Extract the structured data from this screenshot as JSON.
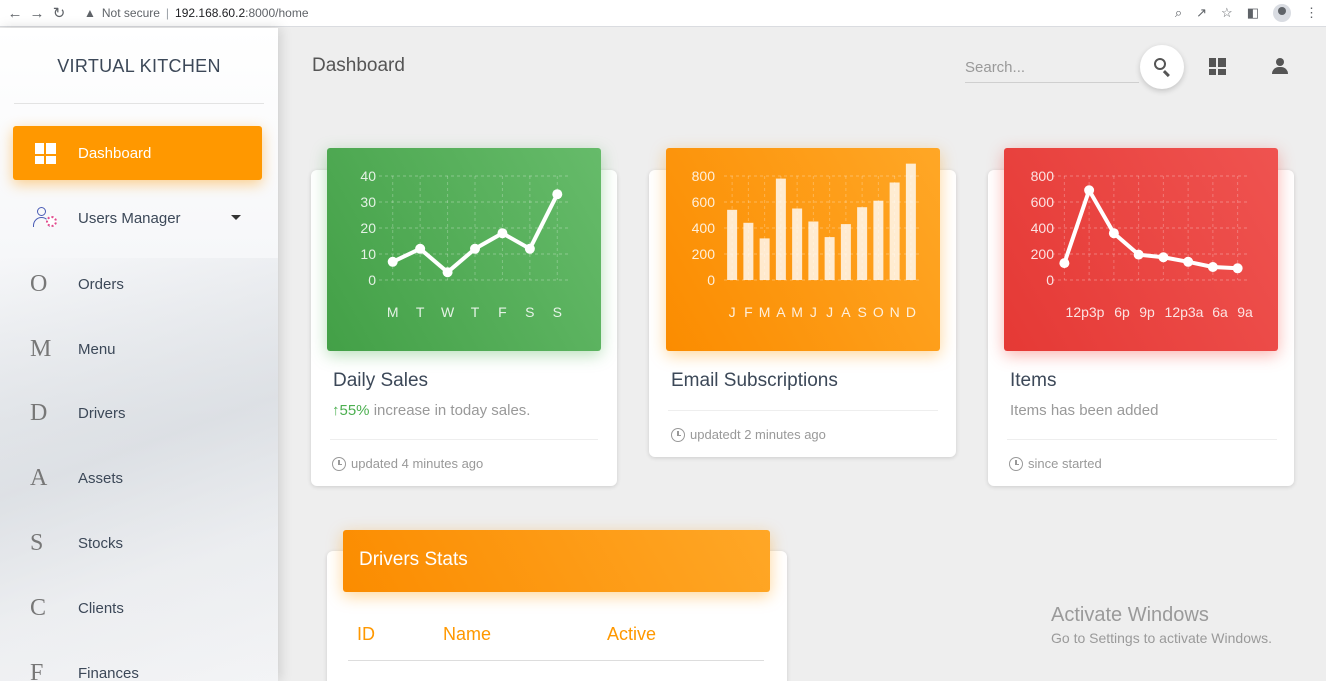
{
  "browser": {
    "warning_text": "Not secure",
    "url_host": "192.168.60.2",
    "url_path": ":8000/home"
  },
  "sidebar": {
    "brand": "VIRTUAL KITCHEN",
    "active_item": "Dashboard",
    "users_manager_label": "Users Manager",
    "items": [
      {
        "letter": "O",
        "label": "Orders"
      },
      {
        "letter": "M",
        "label": "Menu"
      },
      {
        "letter": "D",
        "label": "Drivers"
      },
      {
        "letter": "A",
        "label": "Assets"
      },
      {
        "letter": "S",
        "label": "Stocks"
      },
      {
        "letter": "C",
        "label": "Clients"
      },
      {
        "letter": "F",
        "label": "Finances"
      }
    ]
  },
  "header": {
    "title": "Dashboard",
    "search_placeholder": "Search..."
  },
  "cards": {
    "daily_sales": {
      "title": "Daily Sales",
      "percent": "55%",
      "category": " increase in today sales.",
      "footer": "updated 4 minutes ago"
    },
    "email": {
      "title": "Email Subscriptions",
      "footer": "updatedt 2 minutes ago"
    },
    "items": {
      "title": "Items",
      "category": "Items has been added",
      "footer": "since started"
    }
  },
  "drivers": {
    "title": "Drivers Stats",
    "columns": [
      "ID",
      "Name",
      "Active"
    ]
  },
  "watermark": {
    "title": "Activate Windows",
    "subtitle": "Go to Settings to activate Windows."
  },
  "colors": {
    "accent": "#ff9800",
    "green": "#4caf50",
    "red": "#f44336"
  },
  "chart_data": [
    {
      "type": "line",
      "categories": [
        "M",
        "T",
        "W",
        "T",
        "F",
        "S",
        "S"
      ],
      "values": [
        7,
        12,
        3,
        12,
        18,
        12,
        33
      ],
      "yticks": [
        0,
        10,
        20,
        30,
        40
      ],
      "ylim": [
        0,
        40
      ]
    },
    {
      "type": "bar",
      "categories": [
        "J",
        "F",
        "M",
        "A",
        "M",
        "J",
        "J",
        "A",
        "S",
        "O",
        "N",
        "D"
      ],
      "values": [
        540,
        440,
        320,
        780,
        550,
        450,
        330,
        430,
        560,
        610,
        750,
        895
      ],
      "yticks": [
        0,
        200,
        400,
        600,
        800
      ],
      "ylim": [
        0,
        800
      ]
    },
    {
      "type": "line",
      "categories": [
        "12p",
        "3p",
        "6p",
        "9p",
        "12p",
        "3a",
        "6a",
        "9a"
      ],
      "tick_labels": [
        "12p3p",
        "6p",
        "9p",
        "12p3a",
        "6a",
        "9a"
      ],
      "values": [
        130,
        690,
        360,
        195,
        175,
        140,
        100,
        90
      ],
      "yticks": [
        0,
        200,
        400,
        600,
        800
      ],
      "ylim": [
        0,
        800
      ]
    }
  ]
}
